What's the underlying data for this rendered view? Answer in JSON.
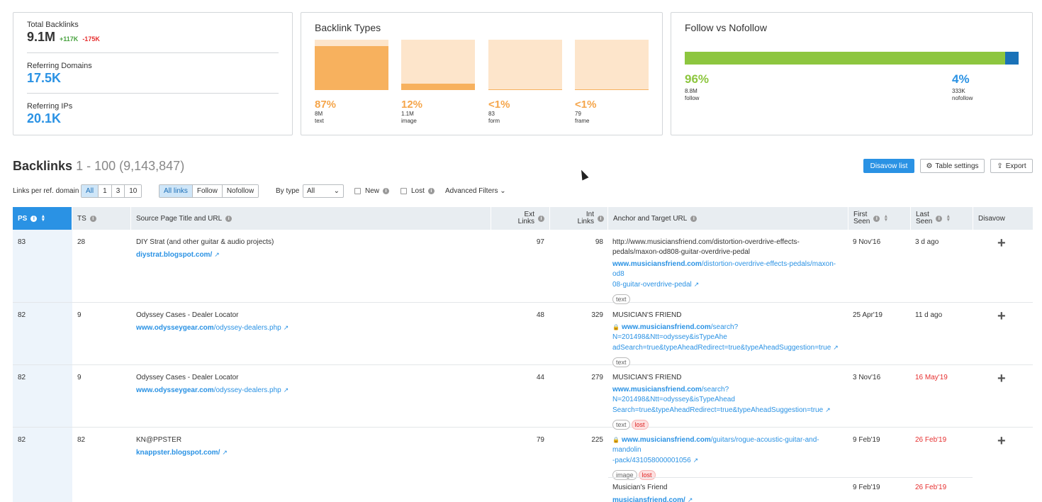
{
  "overview": {
    "total_backlinks": {
      "label": "Total Backlinks",
      "value": "9.1M",
      "up": "+117K",
      "down": "-175K"
    },
    "referring_domains": {
      "label": "Referring Domains",
      "value": "17.5K"
    },
    "referring_ips": {
      "label": "Referring IPs",
      "value": "20.1K"
    }
  },
  "backlink_types": {
    "title": "Backlink Types",
    "items": [
      {
        "pct": "87%",
        "count": "8M",
        "name": "text",
        "fill": 0.87
      },
      {
        "pct": "12%",
        "count": "1.1M",
        "name": "image",
        "fill": 0.12
      },
      {
        "pct": "<1%",
        "count": "83",
        "name": "form",
        "fill": 0.02
      },
      {
        "pct": "<1%",
        "count": "79",
        "name": "frame",
        "fill": 0.02
      }
    ]
  },
  "follow": {
    "title": "Follow vs Nofollow",
    "follow_pct": "96%",
    "follow_count": "8.8M",
    "follow_label": "follow",
    "nofollow_pct": "4%",
    "nofollow_count": "333K",
    "nofollow_label": "nofollow",
    "follow_fraction": 0.96
  },
  "backlinks": {
    "title": "Backlinks",
    "range": "1 - 100 (9,143,847)",
    "disavow_btn": "Disavow list",
    "table_settings_btn": "Table settings",
    "export_btn": "Export"
  },
  "filters": {
    "links_per_label": "Links per ref. domain",
    "links_per": [
      "All",
      "1",
      "3",
      "10"
    ],
    "link_types": [
      "All links",
      "Follow",
      "Nofollow"
    ],
    "by_type_label": "By type",
    "by_type_value": "All",
    "new_label": "New",
    "lost_label": "Lost",
    "advanced": "Advanced Filters"
  },
  "table": {
    "headers": {
      "ps": "PS",
      "ts": "TS",
      "source": "Source Page Title and URL",
      "ext1": "Ext",
      "ext2": "Links",
      "int1": "Int",
      "int2": "Links",
      "anchor": "Anchor and Target URL",
      "first1": "First",
      "first2": "Seen",
      "last1": "Last",
      "last2": "Seen",
      "disavow": "Disavow"
    },
    "rows": [
      {
        "ps": "83",
        "ts": "28",
        "title": "DIY Strat (and other guitar & audio projects)",
        "src_domain": "diystrat.blogspot.com/",
        "src_path": "",
        "ext": "97",
        "int": "98",
        "anchor1": "http://www.musiciansfriend.com/distortion-overdrive-effects-",
        "anchor2": "pedals/maxon-od808-guitar-overdrive-pedal",
        "target_domain": "www.musiciansfriend.com",
        "target_path1": "/distortion-overdrive-effects-pedals/maxon-od8",
        "target_path2": "08-guitar-overdrive-pedal",
        "tag": "text",
        "first": "9 Nov'16",
        "last": "3 d ago"
      },
      {
        "ps": "82",
        "ts": "9",
        "title": "Odyssey Cases - Dealer Locator",
        "src_domain": "www.odysseygear.com",
        "src_path": "/odyssey-dealers.php",
        "ext": "48",
        "int": "329",
        "anchor": "MUSICIAN'S FRIEND",
        "target_domain": "www.musiciansfriend.com",
        "target_path1": "/search?N=201498&Ntt=odyssey&isTypeAhe",
        "target_path2": "adSearch=true&typeAheadRedirect=true&typeAheadSuggestion=true",
        "tag": "text",
        "first": "25 Apr'19",
        "last": "11 d ago"
      },
      {
        "ps": "82",
        "ts": "9",
        "title": "Odyssey Cases - Dealer Locator",
        "src_domain": "www.odysseygear.com",
        "src_path": "/odyssey-dealers.php",
        "ext": "44",
        "int": "279",
        "anchor": "MUSICIAN'S FRIEND",
        "target_domain": "www.musiciansfriend.com",
        "target_path1": "/search?N=201498&Ntt=odyssey&isTypeAhead",
        "target_path2": "Search=true&typeAheadRedirect=true&typeAheadSuggestion=true",
        "tag": "text",
        "tag2": "lost",
        "first": "3 Nov'16",
        "last": "16 May'19"
      },
      {
        "ps": "82",
        "ts": "82",
        "title": "KN@PPSTER",
        "src_domain": "knappster.blogspot.com/",
        "src_path": "",
        "ext": "79",
        "int": "225",
        "target_domain": "www.musiciansfriend.com",
        "target_path1": "/guitars/rogue-acoustic-guitar-and-mandolin",
        "target_path2": "-pack/431058000001056",
        "tag": "image",
        "tag2": "lost",
        "first": "9 Feb'19",
        "last": "26 Feb'19",
        "sub_anchor": "Musician's Friend",
        "sub_domain": "musiciansfriend.com/",
        "sub_first": "9 Feb'19",
        "sub_last": "26 Feb'19"
      }
    ]
  }
}
